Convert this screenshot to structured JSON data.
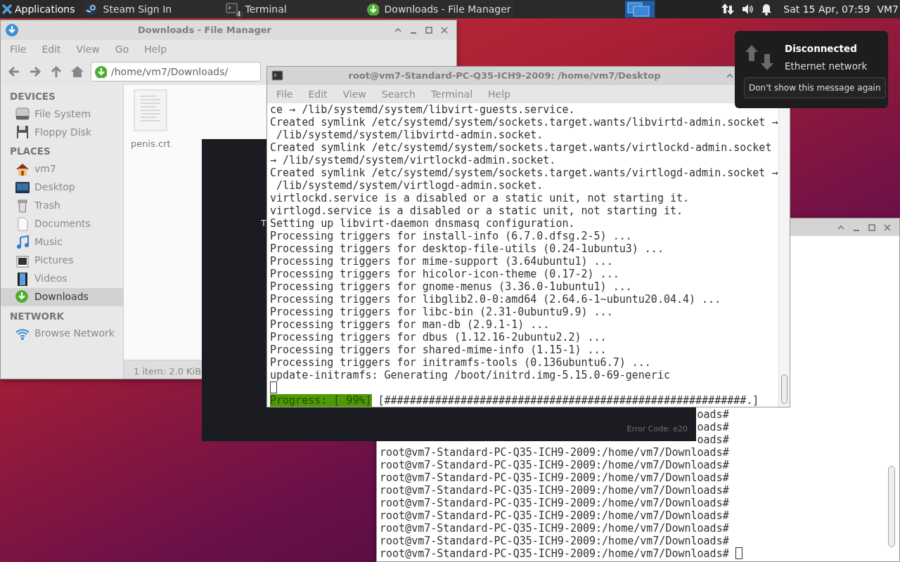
{
  "top_panel": {
    "applications": "Applications",
    "tasks": [
      {
        "label": "Steam Sign In",
        "kind": "steam"
      },
      {
        "label": "Terminal",
        "kind": "terminal",
        "badge": "4"
      },
      {
        "label": "Downloads - File Manager",
        "kind": "download"
      }
    ],
    "clock": "Sat 15 Apr, 07:59",
    "user": "VM7"
  },
  "file_manager": {
    "title": "Downloads - File Manager",
    "menu": [
      "File",
      "Edit",
      "View",
      "Go",
      "Help"
    ],
    "location": "/home/vm7/Downloads/",
    "sidebar": [
      {
        "heading": "DEVICES",
        "items": [
          {
            "label": "File System",
            "kind": "drive",
            "selected": false
          },
          {
            "label": "Floppy Disk",
            "kind": "floppy",
            "selected": false
          }
        ]
      },
      {
        "heading": "PLACES",
        "items": [
          {
            "label": "vm7",
            "kind": "home",
            "selected": false
          },
          {
            "label": "Desktop",
            "kind": "desktop",
            "selected": false
          },
          {
            "label": "Trash",
            "kind": "trash",
            "selected": false
          },
          {
            "label": "Documents",
            "kind": "document",
            "selected": false
          },
          {
            "label": "Music",
            "kind": "music",
            "selected": false
          },
          {
            "label": "Pictures",
            "kind": "pictures",
            "selected": false
          },
          {
            "label": "Videos",
            "kind": "videos",
            "selected": false
          },
          {
            "label": "Downloads",
            "kind": "download",
            "selected": true
          }
        ]
      },
      {
        "heading": "NETWORK",
        "items": [
          {
            "label": "Browse Network",
            "kind": "network",
            "selected": false
          }
        ]
      }
    ],
    "files": [
      {
        "name": "penis.crt"
      }
    ],
    "status": "1 item: 2.0 KiB"
  },
  "dark_window": {
    "partial_text": "T",
    "error_code": "Error Code: e20"
  },
  "terminal": {
    "title": "root@vm7-Standard-PC-Q35-ICH9-2009: /home/vm7/Desktop",
    "menu": [
      "File",
      "Edit",
      "View",
      "Search",
      "Terminal",
      "Help"
    ],
    "lines": [
      "ce → /lib/systemd/system/libvirt-guests.service.",
      "Created symlink /etc/systemd/system/sockets.target.wants/libvirtd-admin.socket →",
      " /lib/systemd/system/libvirtd-admin.socket.",
      "Created symlink /etc/systemd/system/sockets.target.wants/virtlockd-admin.socket",
      "→ /lib/systemd/system/virtlockd-admin.socket.",
      "Created symlink /etc/systemd/system/sockets.target.wants/virtlogd-admin.socket →",
      " /lib/systemd/system/virtlogd-admin.socket.",
      "virtlockd.service is a disabled or a static unit, not starting it.",
      "virtlogd.service is a disabled or a static unit, not starting it.",
      "Setting up libvirt-daemon dnsmasq configuration.",
      "Processing triggers for install-info (6.7.0.dfsg.2-5) ...",
      "Processing triggers for desktop-file-utils (0.24-1ubuntu3) ...",
      "Processing triggers for mime-support (3.64ubuntu1) ...",
      "Processing triggers for hicolor-icon-theme (0.17-2) ...",
      "Processing triggers for gnome-menus (3.36.0-1ubuntu1) ...",
      "Processing triggers for libglib2.0-0:amd64 (2.64.6-1~ubuntu20.04.4) ...",
      "Processing triggers for libc-bin (2.31-0ubuntu9.9) ...",
      "Processing triggers for man-db (2.9.1-1) ...",
      "Processing triggers for dbus (1.12.16-2ubuntu2.2) ...",
      "Processing triggers for shared-mime-info (1.15-1) ...",
      "Processing triggers for initramfs-tools (0.136ubuntu6.7) ...",
      "update-initramfs: Generating /boot/initrd.img-5.15.0-69-generic"
    ],
    "progress_label": "Progress: [ 99%]",
    "progress_bar": "[#########################################################.]"
  },
  "back_terminal": {
    "lines": [
      {
        "text": "oads#",
        "kind": "partial"
      },
      {
        "text": "oads#",
        "kind": "partial"
      },
      {
        "text": "oads#",
        "kind": "partial"
      },
      {
        "text": "root@vm7-Standard-PC-Q35-ICH9-2009:/home/vm7/Downloads#",
        "kind": "full"
      },
      {
        "text": "root@vm7-Standard-PC-Q35-ICH9-2009:/home/vm7/Downloads#",
        "kind": "full"
      },
      {
        "text": "root@vm7-Standard-PC-Q35-ICH9-2009:/home/vm7/Downloads#",
        "kind": "full"
      },
      {
        "text": "root@vm7-Standard-PC-Q35-ICH9-2009:/home/vm7/Downloads#",
        "kind": "full"
      },
      {
        "text": "root@vm7-Standard-PC-Q35-ICH9-2009:/home/vm7/Downloads#",
        "kind": "full"
      },
      {
        "text": "root@vm7-Standard-PC-Q35-ICH9-2009:/home/vm7/Downloads#",
        "kind": "full"
      },
      {
        "text": "root@vm7-Standard-PC-Q35-ICH9-2009:/home/vm7/Downloads#",
        "kind": "full"
      },
      {
        "text": "root@vm7-Standard-PC-Q35-ICH9-2009:/home/vm7/Downloads#",
        "kind": "full"
      },
      {
        "text": "root@vm7-Standard-PC-Q35-ICH9-2009:/home/vm7/Downloads#",
        "kind": "prompt"
      }
    ]
  },
  "notification": {
    "title": "Disconnected",
    "body": "Ethernet network",
    "button": "Don't show this message again"
  }
}
